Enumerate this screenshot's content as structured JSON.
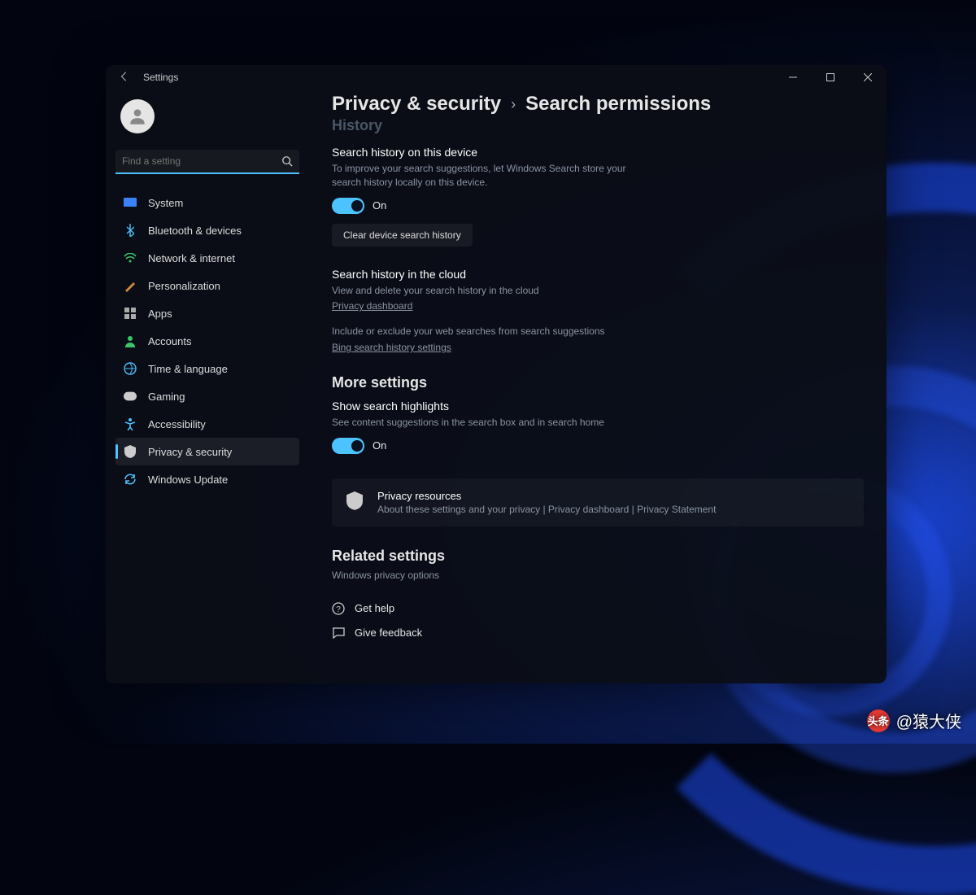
{
  "window": {
    "title": "Settings"
  },
  "search": {
    "placeholder": "Find a setting"
  },
  "sidebar": {
    "items": [
      {
        "label": "System",
        "icon": "system-icon"
      },
      {
        "label": "Bluetooth & devices",
        "icon": "bluetooth-icon"
      },
      {
        "label": "Network & internet",
        "icon": "network-icon"
      },
      {
        "label": "Personalization",
        "icon": "personalization-icon"
      },
      {
        "label": "Apps",
        "icon": "apps-icon"
      },
      {
        "label": "Accounts",
        "icon": "accounts-icon"
      },
      {
        "label": "Time & language",
        "icon": "time-language-icon"
      },
      {
        "label": "Gaming",
        "icon": "gaming-icon"
      },
      {
        "label": "Accessibility",
        "icon": "accessibility-icon"
      },
      {
        "label": "Privacy & security",
        "icon": "privacy-security-icon"
      },
      {
        "label": "Windows Update",
        "icon": "windows-update-icon"
      }
    ],
    "active_index": 9
  },
  "breadcrumb": {
    "parent": "Privacy & security",
    "sep": "›",
    "page": "Search permissions"
  },
  "partial_heading": "History",
  "sections": {
    "history_device": {
      "title": "Search history on this device",
      "desc": "To improve your search suggestions, let Windows Search store your search history locally on this device.",
      "toggle_state": "On",
      "clear_button": "Clear device search history"
    },
    "history_cloud": {
      "title": "Search history in the cloud",
      "desc": "View and delete your search history in the cloud",
      "link1": "Privacy dashboard",
      "desc2": "Include or exclude your web searches from search suggestions",
      "link2": "Bing search history settings"
    },
    "more_settings": {
      "heading": "More settings",
      "highlights_title": "Show search highlights",
      "highlights_desc": "See content suggestions in the search box and in search home",
      "highlights_state": "On"
    },
    "privacy_resources": {
      "title": "Privacy resources",
      "subtitle": "About these settings and your privacy | Privacy dashboard | Privacy Statement"
    },
    "related": {
      "heading": "Related settings",
      "link": "Windows privacy options"
    },
    "footer": {
      "help": "Get help",
      "feedback": "Give feedback"
    }
  },
  "watermark": {
    "logo": "头条",
    "user": "@猿大侠"
  }
}
